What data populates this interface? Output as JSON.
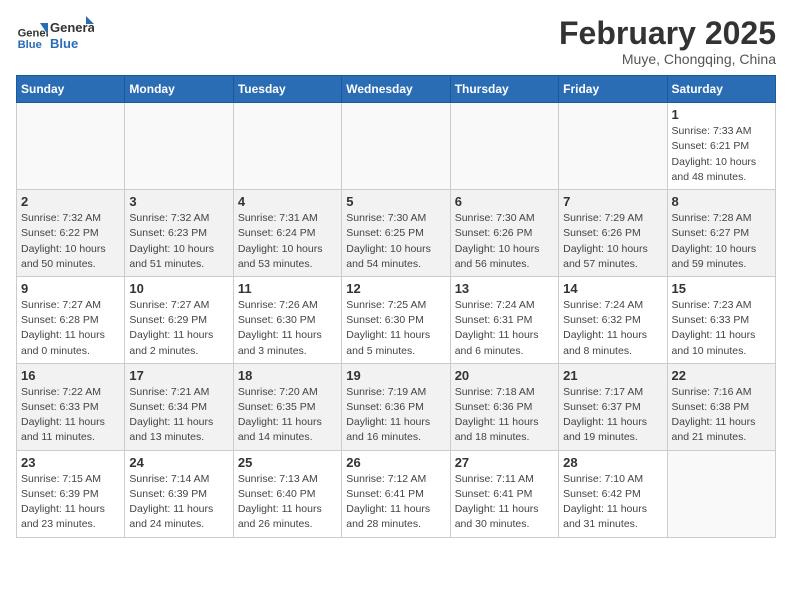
{
  "header": {
    "logo_general": "General",
    "logo_blue": "Blue",
    "month_title": "February 2025",
    "location": "Muye, Chongqing, China"
  },
  "weekdays": [
    "Sunday",
    "Monday",
    "Tuesday",
    "Wednesday",
    "Thursday",
    "Friday",
    "Saturday"
  ],
  "weeks": [
    [
      {
        "day": "",
        "info": ""
      },
      {
        "day": "",
        "info": ""
      },
      {
        "day": "",
        "info": ""
      },
      {
        "day": "",
        "info": ""
      },
      {
        "day": "",
        "info": ""
      },
      {
        "day": "",
        "info": ""
      },
      {
        "day": "1",
        "info": "Sunrise: 7:33 AM\nSunset: 6:21 PM\nDaylight: 10 hours and 48 minutes."
      }
    ],
    [
      {
        "day": "2",
        "info": "Sunrise: 7:32 AM\nSunset: 6:22 PM\nDaylight: 10 hours and 50 minutes."
      },
      {
        "day": "3",
        "info": "Sunrise: 7:32 AM\nSunset: 6:23 PM\nDaylight: 10 hours and 51 minutes."
      },
      {
        "day": "4",
        "info": "Sunrise: 7:31 AM\nSunset: 6:24 PM\nDaylight: 10 hours and 53 minutes."
      },
      {
        "day": "5",
        "info": "Sunrise: 7:30 AM\nSunset: 6:25 PM\nDaylight: 10 hours and 54 minutes."
      },
      {
        "day": "6",
        "info": "Sunrise: 7:30 AM\nSunset: 6:26 PM\nDaylight: 10 hours and 56 minutes."
      },
      {
        "day": "7",
        "info": "Sunrise: 7:29 AM\nSunset: 6:26 PM\nDaylight: 10 hours and 57 minutes."
      },
      {
        "day": "8",
        "info": "Sunrise: 7:28 AM\nSunset: 6:27 PM\nDaylight: 10 hours and 59 minutes."
      }
    ],
    [
      {
        "day": "9",
        "info": "Sunrise: 7:27 AM\nSunset: 6:28 PM\nDaylight: 11 hours and 0 minutes."
      },
      {
        "day": "10",
        "info": "Sunrise: 7:27 AM\nSunset: 6:29 PM\nDaylight: 11 hours and 2 minutes."
      },
      {
        "day": "11",
        "info": "Sunrise: 7:26 AM\nSunset: 6:30 PM\nDaylight: 11 hours and 3 minutes."
      },
      {
        "day": "12",
        "info": "Sunrise: 7:25 AM\nSunset: 6:30 PM\nDaylight: 11 hours and 5 minutes."
      },
      {
        "day": "13",
        "info": "Sunrise: 7:24 AM\nSunset: 6:31 PM\nDaylight: 11 hours and 6 minutes."
      },
      {
        "day": "14",
        "info": "Sunrise: 7:24 AM\nSunset: 6:32 PM\nDaylight: 11 hours and 8 minutes."
      },
      {
        "day": "15",
        "info": "Sunrise: 7:23 AM\nSunset: 6:33 PM\nDaylight: 11 hours and 10 minutes."
      }
    ],
    [
      {
        "day": "16",
        "info": "Sunrise: 7:22 AM\nSunset: 6:33 PM\nDaylight: 11 hours and 11 minutes."
      },
      {
        "day": "17",
        "info": "Sunrise: 7:21 AM\nSunset: 6:34 PM\nDaylight: 11 hours and 13 minutes."
      },
      {
        "day": "18",
        "info": "Sunrise: 7:20 AM\nSunset: 6:35 PM\nDaylight: 11 hours and 14 minutes."
      },
      {
        "day": "19",
        "info": "Sunrise: 7:19 AM\nSunset: 6:36 PM\nDaylight: 11 hours and 16 minutes."
      },
      {
        "day": "20",
        "info": "Sunrise: 7:18 AM\nSunset: 6:36 PM\nDaylight: 11 hours and 18 minutes."
      },
      {
        "day": "21",
        "info": "Sunrise: 7:17 AM\nSunset: 6:37 PM\nDaylight: 11 hours and 19 minutes."
      },
      {
        "day": "22",
        "info": "Sunrise: 7:16 AM\nSunset: 6:38 PM\nDaylight: 11 hours and 21 minutes."
      }
    ],
    [
      {
        "day": "23",
        "info": "Sunrise: 7:15 AM\nSunset: 6:39 PM\nDaylight: 11 hours and 23 minutes."
      },
      {
        "day": "24",
        "info": "Sunrise: 7:14 AM\nSunset: 6:39 PM\nDaylight: 11 hours and 24 minutes."
      },
      {
        "day": "25",
        "info": "Sunrise: 7:13 AM\nSunset: 6:40 PM\nDaylight: 11 hours and 26 minutes."
      },
      {
        "day": "26",
        "info": "Sunrise: 7:12 AM\nSunset: 6:41 PM\nDaylight: 11 hours and 28 minutes."
      },
      {
        "day": "27",
        "info": "Sunrise: 7:11 AM\nSunset: 6:41 PM\nDaylight: 11 hours and 30 minutes."
      },
      {
        "day": "28",
        "info": "Sunrise: 7:10 AM\nSunset: 6:42 PM\nDaylight: 11 hours and 31 minutes."
      },
      {
        "day": "",
        "info": ""
      }
    ]
  ]
}
